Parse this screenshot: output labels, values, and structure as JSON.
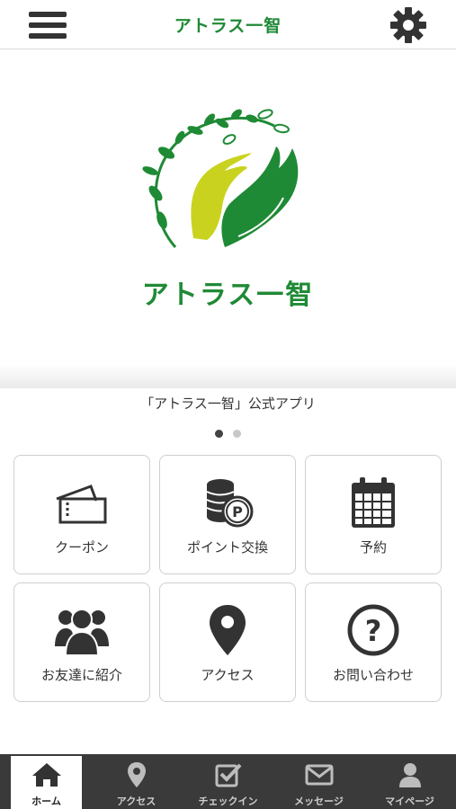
{
  "header": {
    "title": "アトラス一智",
    "menu_icon": "hamburger-menu-icon",
    "settings_icon": "gear-icon"
  },
  "hero": {
    "logo_text": "アトラス一智",
    "caption": "「アトラス一智」公式アプリ",
    "slide_count": 2,
    "active_slide": 1
  },
  "tiles": [
    {
      "label": "クーポン",
      "icon": "ticket-icon"
    },
    {
      "label": "ポイント交換",
      "icon": "coin-point-icon"
    },
    {
      "label": "予約",
      "icon": "calendar-icon"
    },
    {
      "label": "お友達に紹介",
      "icon": "group-icon"
    },
    {
      "label": "アクセス",
      "icon": "map-pin-icon"
    },
    {
      "label": "お問い合わせ",
      "icon": "question-icon"
    }
  ],
  "bottom_nav": [
    {
      "label": "ホーム",
      "icon": "home-icon",
      "active": true
    },
    {
      "label": "アクセス",
      "icon": "map-pin-icon",
      "active": false
    },
    {
      "label": "チェックイン",
      "icon": "checkin-icon",
      "active": false
    },
    {
      "label": "メッセージ",
      "icon": "envelope-icon",
      "active": false
    },
    {
      "label": "マイページ",
      "icon": "user-icon",
      "active": false
    }
  ],
  "colors": {
    "brand_green": "#1f8a35",
    "leaf_yellow": "#c9d31f",
    "nav_bg": "#3a3a3a",
    "icon_dark": "#333333"
  }
}
